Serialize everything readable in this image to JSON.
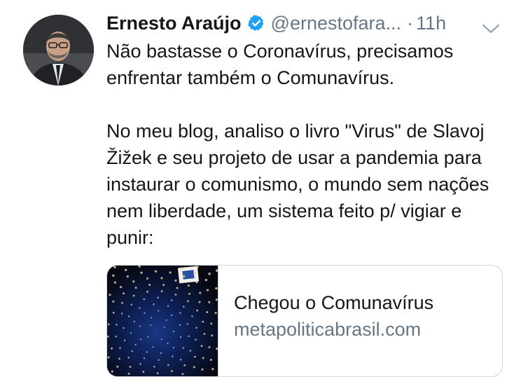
{
  "author": {
    "display_name": "Ernesto Araújo",
    "handle": "@ernestofara...",
    "verified": true,
    "separator": "·",
    "time": "11h"
  },
  "tweet": {
    "paragraphs": [
      "Não bastasse o Coronavírus, precisamos enfrentar também o Comunavírus.",
      "No meu blog, analiso o livro \"Virus\" de Slavoj Žižek e seu projeto de usar a pandemia para instaurar o comunismo, o mundo sem nações nem liberdade, um sistema feito p/ vigiar e punir:"
    ]
  },
  "link_card": {
    "title": "Chegou o Comunavírus",
    "domain": "metapoliticabrasil.com"
  },
  "colors": {
    "text": "#14171a",
    "secondary": "#657786",
    "verified_blue": "#1da1f2",
    "border": "#ccd6dd"
  },
  "icons": {
    "verified": "verified-badge-icon",
    "caret": "chevron-down-icon"
  }
}
